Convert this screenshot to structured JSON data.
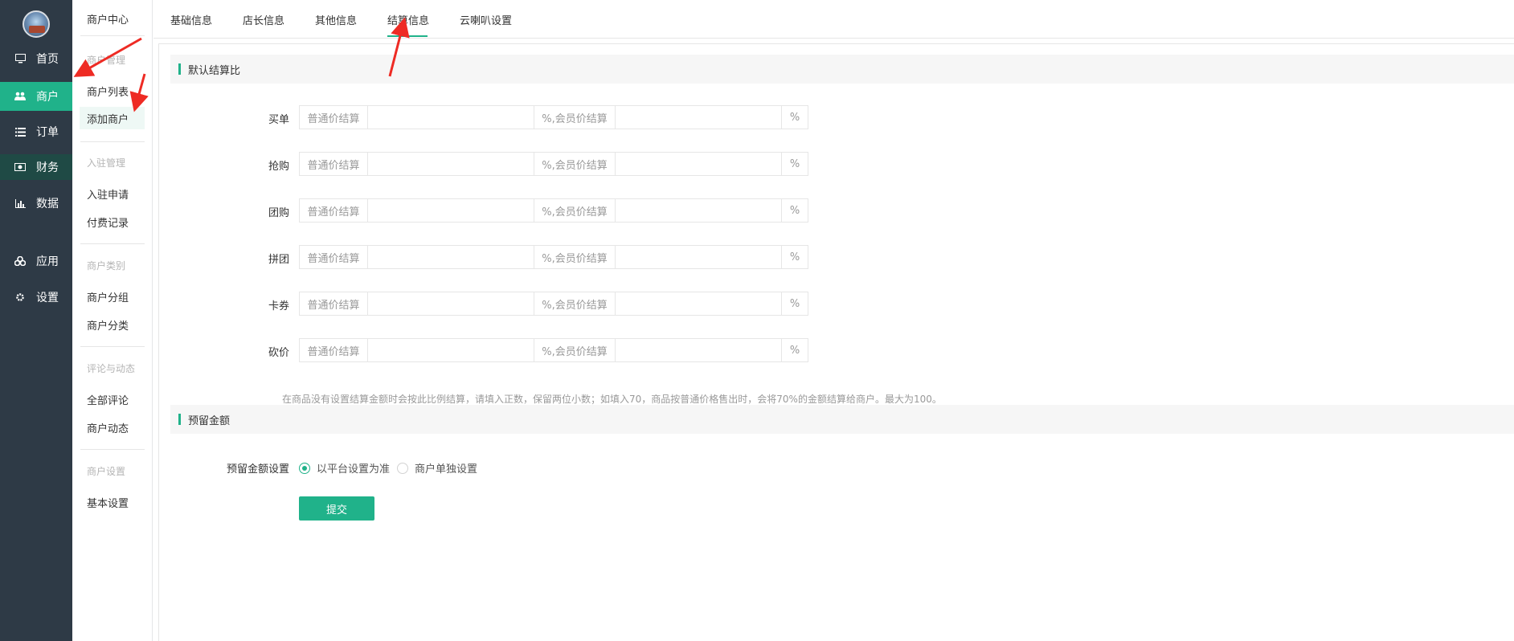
{
  "sidebar": {
    "items": [
      {
        "label": "首页",
        "icon": "monitor-icon"
      },
      {
        "label": "商户",
        "icon": "users-icon"
      },
      {
        "label": "订单",
        "icon": "list-icon"
      },
      {
        "label": "财务",
        "icon": "money-icon"
      },
      {
        "label": "数据",
        "icon": "bar-chart-icon"
      },
      {
        "label": "应用",
        "icon": "cubes-icon"
      },
      {
        "label": "设置",
        "icon": "gear-icon"
      }
    ]
  },
  "subnav": {
    "title": "商户中心",
    "groups": [
      {
        "header": "商户管理",
        "links": [
          "商户列表",
          "添加商户"
        ]
      },
      {
        "header": "入驻管理",
        "links": [
          "入驻申请",
          "付费记录"
        ]
      },
      {
        "header": "商户类别",
        "links": [
          "商户分组",
          "商户分类"
        ]
      },
      {
        "header": "评论与动态",
        "links": [
          "全部评论",
          "商户动态"
        ]
      },
      {
        "header": "商户设置",
        "links": [
          "基本设置"
        ]
      }
    ]
  },
  "tabs": [
    {
      "label": "基础信息"
    },
    {
      "label": "店长信息"
    },
    {
      "label": "其他信息"
    },
    {
      "label": "结算信息"
    },
    {
      "label": "云喇叭设置"
    }
  ],
  "section1": {
    "title": "默认结算比"
  },
  "settlement_rows": [
    {
      "label": "买单",
      "addon_left": "普通价结算",
      "addon_mid": "%,会员价结算",
      "addon_right": "%"
    },
    {
      "label": "抢购",
      "addon_left": "普通价结算",
      "addon_mid": "%,会员价结算",
      "addon_right": "%"
    },
    {
      "label": "团购",
      "addon_left": "普通价结算",
      "addon_mid": "%,会员价结算",
      "addon_right": "%"
    },
    {
      "label": "拼团",
      "addon_left": "普通价结算",
      "addon_mid": "%,会员价结算",
      "addon_right": "%"
    },
    {
      "label": "卡券",
      "addon_left": "普通价结算",
      "addon_mid": "%,会员价结算",
      "addon_right": "%"
    },
    {
      "label": "砍价",
      "addon_left": "普通价结算",
      "addon_mid": "%,会员价结算",
      "addon_right": "%"
    }
  ],
  "hint": "在商品没有设置结算金额时会按此比例结算，请填入正数，保留两位小数；如填入70，商品按普通价格售出时，会将70%的金额结算给商户。最大为100。",
  "section2": {
    "title": "预留金额"
  },
  "reserve": {
    "label": "预留金额设置",
    "options": [
      "以平台设置为准",
      "商户单独设置"
    ],
    "selected": 0
  },
  "submit_label": "提交",
  "colors": {
    "accent": "#20b28a",
    "sidebar": "#2e3a46",
    "annotation": "#ee2b24"
  }
}
